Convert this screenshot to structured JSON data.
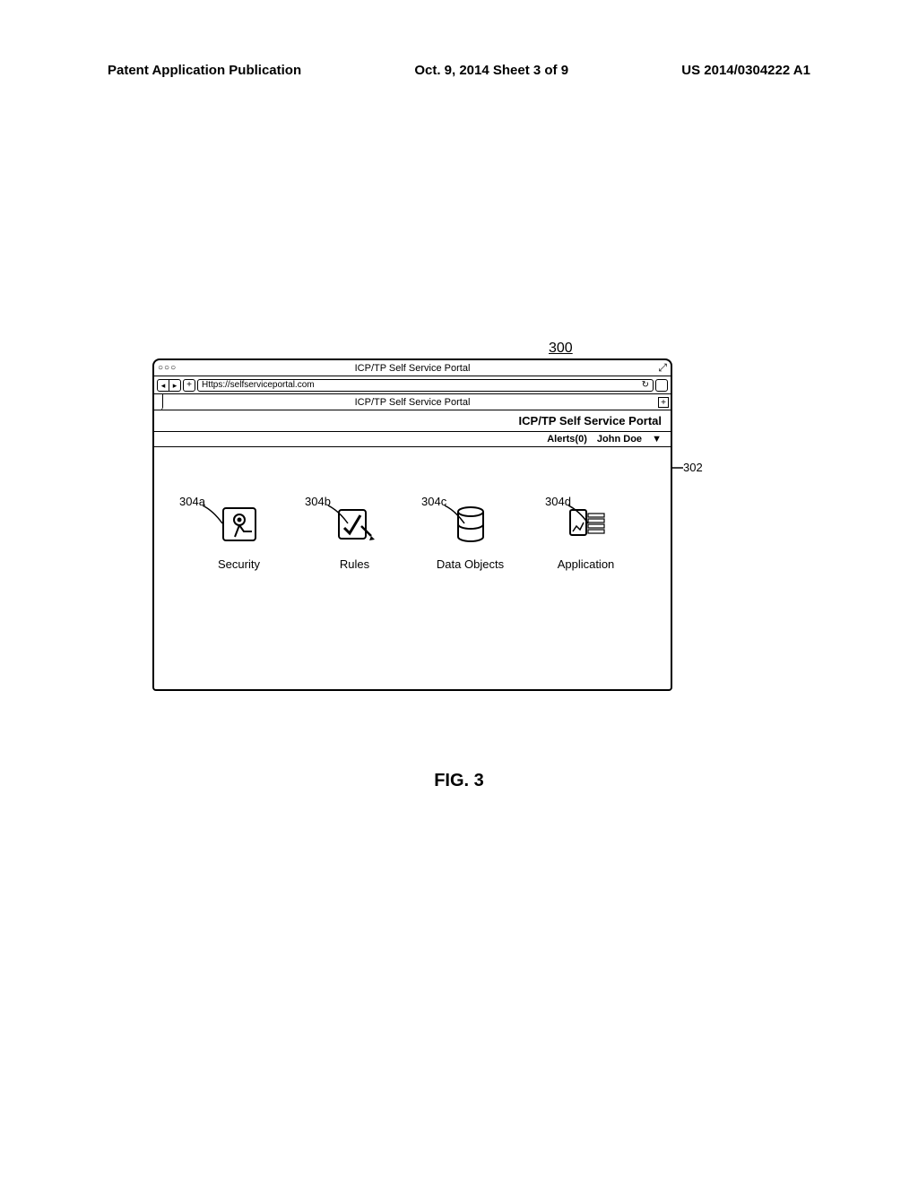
{
  "header": {
    "left": "Patent Application Publication",
    "center": "Oct. 9, 2014  Sheet 3 of 9",
    "right": "US 2014/0304222 A1"
  },
  "figure_ref": "300",
  "browser": {
    "window_title": "ICP/TP Self Service Portal",
    "url": "Https://selfserviceportal.com",
    "tab_label": "ICP/TP Self Service Portal"
  },
  "portal": {
    "brand": "ICP/TP Self Service Portal",
    "alerts_label": "Alerts(0)",
    "user": "John Doe"
  },
  "tiles": {
    "security": "Security",
    "rules": "Rules",
    "data_objects": "Data Objects",
    "application": "Application"
  },
  "callouts": {
    "c302": "302",
    "c304a": "304a",
    "c304b": "304b",
    "c304c": "304c",
    "c304d": "304d"
  },
  "figure_caption": "FIG. 3"
}
